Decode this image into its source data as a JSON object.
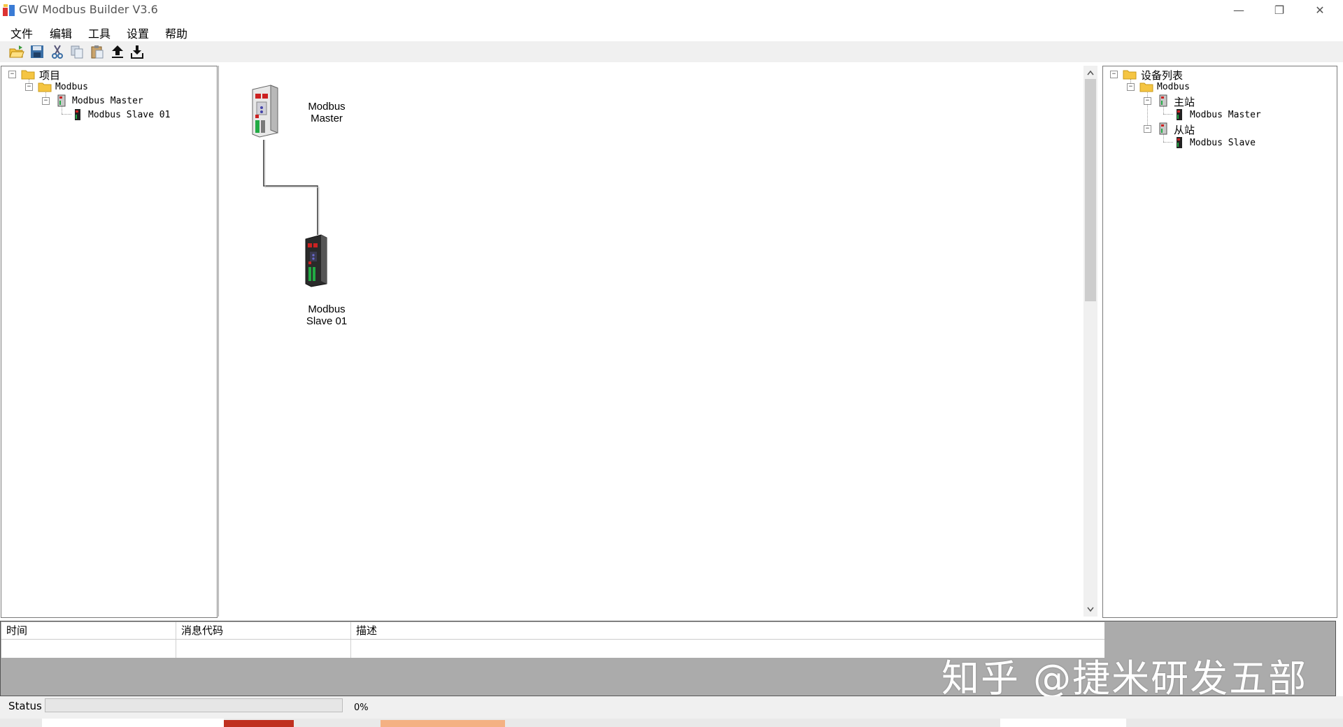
{
  "window": {
    "title": "GW Modbus Builder V3.6",
    "controls": [
      "—",
      "❐",
      "✕"
    ]
  },
  "menu": {
    "items": [
      "文件",
      "编辑",
      "工具",
      "设置",
      "帮助"
    ]
  },
  "toolbar": {
    "icons": [
      "open-folder-icon",
      "save-icon",
      "cut-icon",
      "copy-icon",
      "paste-icon",
      "upload-icon",
      "download-icon"
    ]
  },
  "project_tree": {
    "root": "项目",
    "protocol": "Modbus",
    "master": "Modbus Master",
    "slave": "Modbus Slave  01"
  },
  "canvas": {
    "master_label_1": "Modbus",
    "master_label_2": "Master",
    "slave_label_1": "Modbus",
    "slave_label_2": "Slave  01"
  },
  "device_tree": {
    "root": "设备列表",
    "protocol": "Modbus",
    "master_group": "主站",
    "master_item": "Modbus Master",
    "slave_group": "从站",
    "slave_item": "Modbus Slave"
  },
  "log": {
    "columns": [
      "时间",
      "消息代码",
      "描述"
    ]
  },
  "status": {
    "label": "Status",
    "progress_percent": "0%",
    "progress_value": 0
  },
  "watermark": "知乎 @捷米研发五部",
  "colors": {
    "folder": "#f5c542",
    "device_red": "#cc2222",
    "device_green": "#22aa44",
    "log_bg": "#ababab"
  }
}
